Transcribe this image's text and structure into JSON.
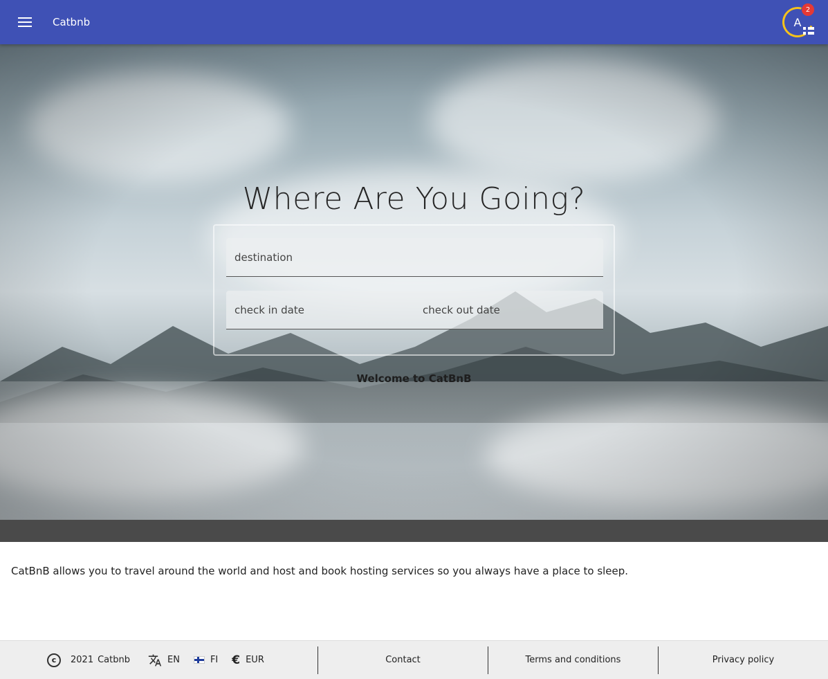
{
  "header": {
    "title": "Catbnb",
    "avatar_letter": "A",
    "notification_count": "2",
    "menu_icon": "menu-icon"
  },
  "hero": {
    "heading": "Where Are You Going?",
    "destination_placeholder": "destination",
    "checkin_placeholder": "check in date",
    "checkout_placeholder": "check out date",
    "welcome": "Welcome to CatBnB"
  },
  "description": "CatBnB allows you to travel around the world and host and book hosting services so you always have a place to sleep.",
  "footer": {
    "copyright_icon": "copyright-icon",
    "year": "2021",
    "brand": "Catbnb",
    "language_icon": "translate-icon",
    "language": "EN",
    "country_icon": "finland-flag-icon",
    "country": "FI",
    "currency_icon": "euro-icon",
    "currency": "EUR",
    "contact": "Contact",
    "terms": "Terms and conditions",
    "privacy": "Privacy policy"
  },
  "colors": {
    "primary": "#3f51b5",
    "avatar_ring": "#f6c21b",
    "badge": "#e53935",
    "strip": "#4a4a4a",
    "footer_bg": "#eeeeee"
  }
}
